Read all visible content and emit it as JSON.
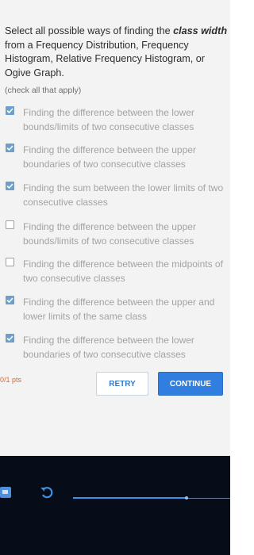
{
  "question": {
    "prefix": "Select all possible ways of finding the ",
    "emphasis": "class width",
    "suffix": " from a Frequency Distribution, Frequency Histogram, Relative Frequency Histogram, or Ogive Graph.",
    "hint": "(check all that apply)"
  },
  "options": [
    {
      "text": "Finding the difference between the lower bounds/limits of two consecutive classes",
      "checked": true
    },
    {
      "text": "Finding the difference between the upper boundaries of two consecutive classes",
      "checked": true
    },
    {
      "text": "Finding the sum between the lower limits of two consecutive classes",
      "checked": true
    },
    {
      "text": "Finding the difference between the upper bounds/limits of two consecutive classes",
      "checked": false
    },
    {
      "text": "Finding the difference between the midpoints of two consecutive classes",
      "checked": false
    },
    {
      "text": "Finding the difference between the upper and lower limits of the same class",
      "checked": true
    },
    {
      "text": "Finding the difference between the lower boundaries of two consecutive classes",
      "checked": true
    }
  ],
  "score": "0/1 pts",
  "buttons": {
    "retry": "RETRY",
    "continue": "CONTINUE"
  },
  "footer": {
    "calculator_icon": "calculator-icon",
    "undo_icon": "undo-icon",
    "slider_progress": 0.72
  },
  "colors": {
    "accent": "#2f7ee0",
    "checkbox": "#6c9fc9",
    "score": "#d66a2a",
    "footer": "#060d19"
  }
}
